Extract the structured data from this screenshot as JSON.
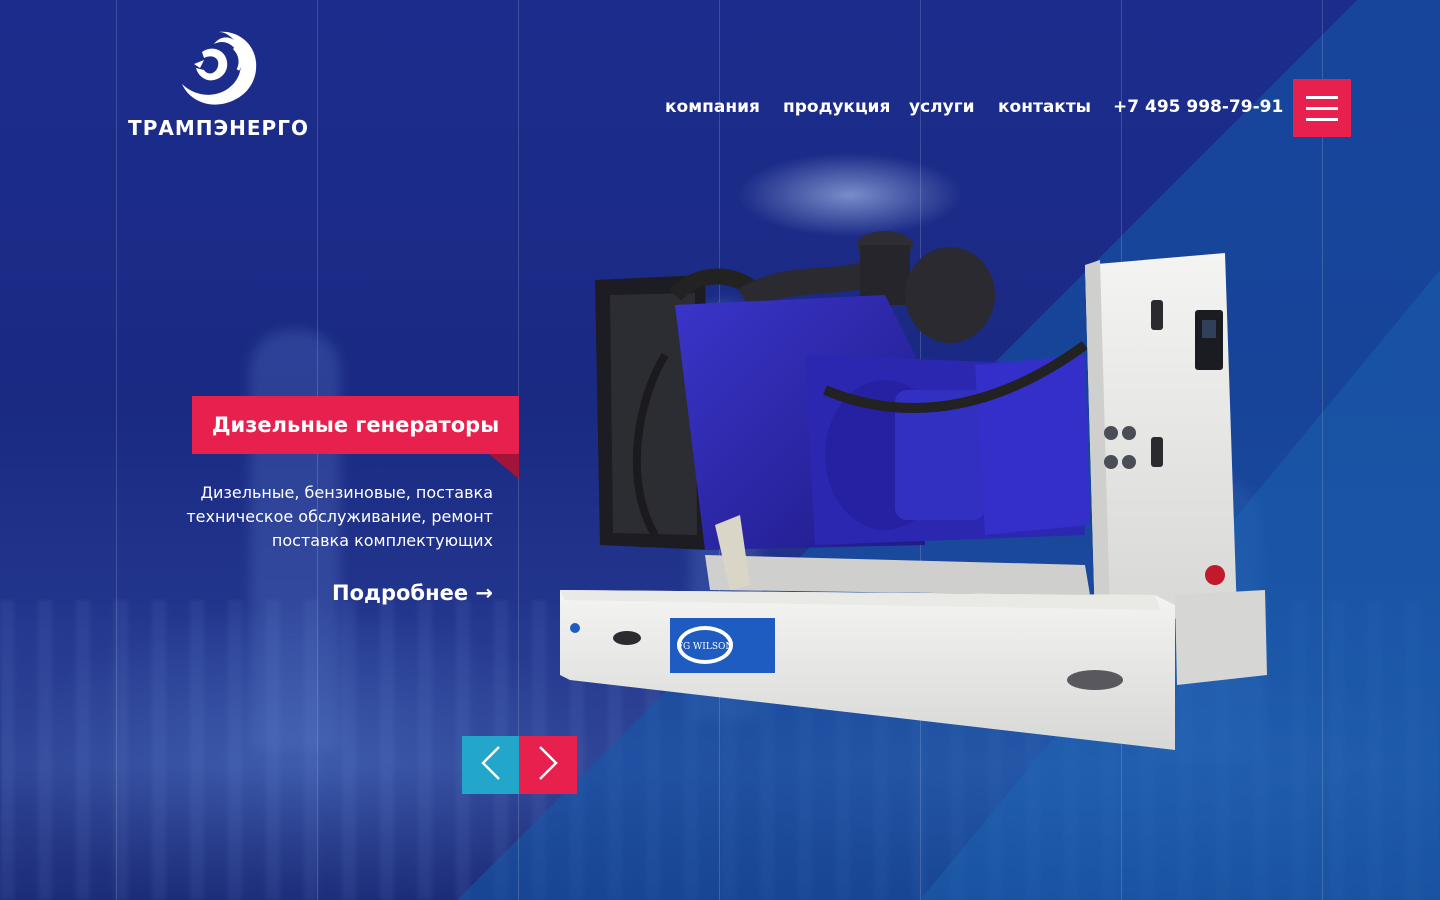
{
  "brand": {
    "name": "ТРАМПЭНЕРГО",
    "logo_icon": "lion-head-icon"
  },
  "nav": {
    "items": [
      {
        "label": "компания"
      },
      {
        "label": "продукция"
      },
      {
        "label": "услуги"
      },
      {
        "label": "контакты"
      }
    ],
    "phone": "+7 495 998-79-91",
    "menu_icon": "hamburger-icon"
  },
  "slide": {
    "title": "Дизельные генераторы",
    "description_lines": [
      "Дизельные, бензиновые, поставка",
      "техническое обслуживание, ремонт",
      "поставка комплектующих"
    ],
    "more_label": "Подробнее →",
    "product_badge": "FG WILSON"
  },
  "slider": {
    "prev_icon": "chevron-left-icon",
    "next_icon": "chevron-right-icon"
  },
  "colors": {
    "accent_red": "#e8204d",
    "accent_teal": "#22a6c9",
    "background": "#1a2a86"
  }
}
